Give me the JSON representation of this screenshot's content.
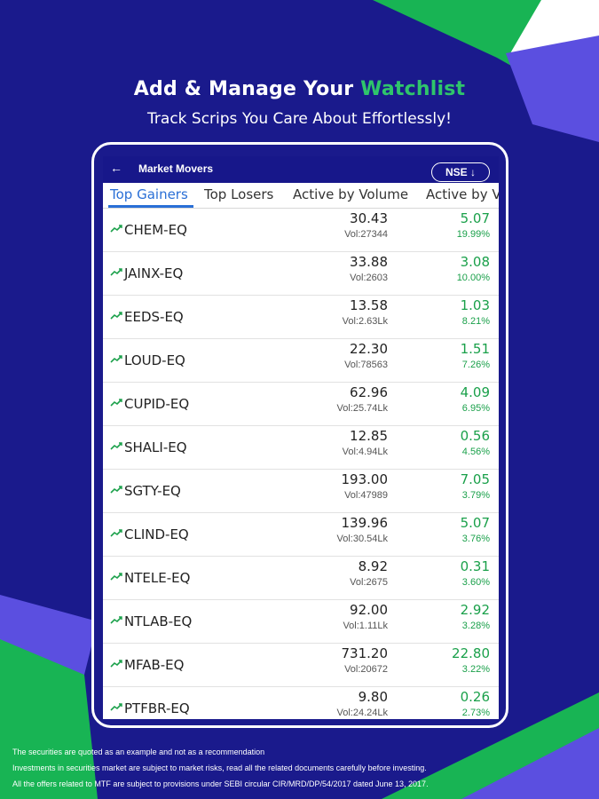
{
  "colors": {
    "background": "#1a1a8c",
    "accent_green": "#2fc56b",
    "tab_active": "#2a6fd6",
    "gain": "#1aa04a"
  },
  "promo": {
    "headline_main": "Add & Manage Your ",
    "headline_accent": "Watchlist",
    "subtitle": "Track Scrips You Care About Effortlessly!"
  },
  "appbar": {
    "back_icon": "arrow-left-icon",
    "title": "Market Movers",
    "exchange": "NSE ↓"
  },
  "tabs": [
    {
      "label": "Top Gainers",
      "active": true
    },
    {
      "label": "Top Losers",
      "active": false
    },
    {
      "label": "Active by Volume",
      "active": false
    },
    {
      "label": "Active by V",
      "active": false
    }
  ],
  "rows": [
    {
      "symbol": "CHEM-EQ",
      "price": "30.43",
      "volume": "Vol:27344",
      "change": "5.07",
      "percent": "19.99%"
    },
    {
      "symbol": "JAINX-EQ",
      "price": "33.88",
      "volume": "Vol:2603",
      "change": "3.08",
      "percent": "10.00%"
    },
    {
      "symbol": "EEDS-EQ",
      "price": "13.58",
      "volume": "Vol:2.63Lk",
      "change": "1.03",
      "percent": "8.21%"
    },
    {
      "symbol": "LOUD-EQ",
      "price": "22.30",
      "volume": "Vol:78563",
      "change": "1.51",
      "percent": "7.26%"
    },
    {
      "symbol": "CUPID-EQ",
      "price": "62.96",
      "volume": "Vol:25.74Lk",
      "change": "4.09",
      "percent": "6.95%"
    },
    {
      "symbol": "SHALI-EQ",
      "price": "12.85",
      "volume": "Vol:4.94Lk",
      "change": "0.56",
      "percent": "4.56%"
    },
    {
      "symbol": "SGTY-EQ",
      "price": "193.00",
      "volume": "Vol:47989",
      "change": "7.05",
      "percent": "3.79%"
    },
    {
      "symbol": "CLIND-EQ",
      "price": "139.96",
      "volume": "Vol:30.54Lk",
      "change": "5.07",
      "percent": "3.76%"
    },
    {
      "symbol": "NTELE-EQ",
      "price": "8.92",
      "volume": "Vol:2675",
      "change": "0.31",
      "percent": "3.60%"
    },
    {
      "symbol": "NTLAB-EQ",
      "price": "92.00",
      "volume": "Vol:1.11Lk",
      "change": "2.92",
      "percent": "3.28%"
    },
    {
      "symbol": "MFAB-EQ",
      "price": "731.20",
      "volume": "Vol:20672",
      "change": "22.80",
      "percent": "3.22%"
    },
    {
      "symbol": "PTFBR-EQ",
      "price": "9.80",
      "volume": "Vol:24.24Lk",
      "change": "0.26",
      "percent": "2.73%"
    }
  ],
  "disclaimer": {
    "line1": "The securities are quoted as an example and not as a recommendation",
    "line2": "Investments in securities market are subject to market risks, read all the related documents carefully before investing.",
    "line3": "All the offers related to MTF are subject to provisions under SEBI circular CIR/MRD/DP/54/2017 dated June 13, 2017."
  }
}
